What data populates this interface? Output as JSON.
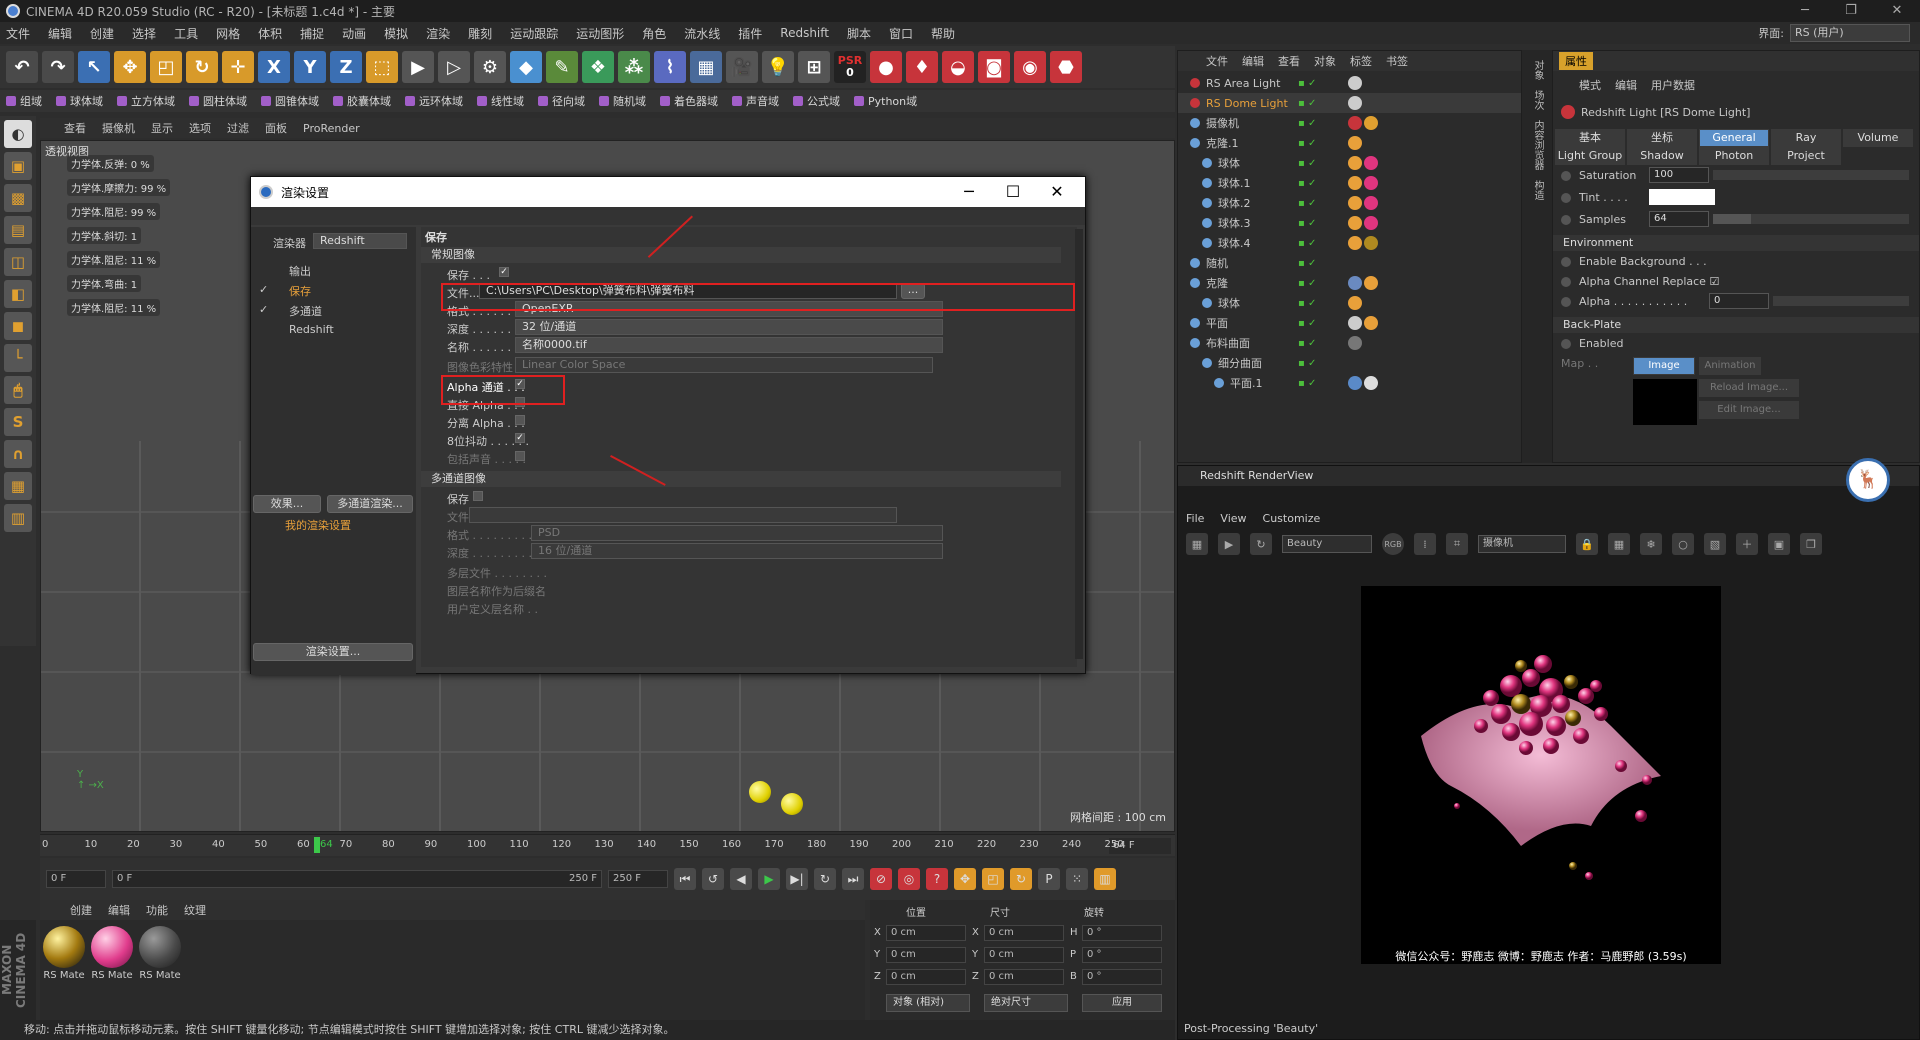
{
  "app": {
    "title": "CINEMA 4D R20.059 Studio (RC - R20) - [未标题 1.c4d *] - 主要",
    "interface_label": "界面:",
    "interface_value": "RS (用户)"
  },
  "menu": [
    "文件",
    "编辑",
    "创建",
    "选择",
    "工具",
    "网格",
    "体积",
    "捕捉",
    "动画",
    "模拟",
    "渲染",
    "雕刻",
    "运动跟踪",
    "运动图形",
    "角色",
    "流水线",
    "插件",
    "Redshift",
    "脚本",
    "窗口",
    "帮助"
  ],
  "toolbar2": [
    "组域",
    "球体域",
    "立方体域",
    "圆柱体域",
    "圆锥体域",
    "胶囊体域",
    "远环体域",
    "线性域",
    "径向域",
    "随机域",
    "着色器域",
    "声音域",
    "公式域",
    "Python域"
  ],
  "psr": "PSR",
  "psr_val": "0",
  "viewport": {
    "menu": [
      "查看",
      "摄像机",
      "显示",
      "选项",
      "过滤",
      "面板",
      "ProRender"
    ],
    "title": "透视视图",
    "grid_spacing": "网格间距 : 100 cm",
    "dynamics": [
      "力学体.反弹:  0 %",
      "力学体.摩擦力:  99 %",
      "力学体.阻尼:  99 %",
      "力学体.斜切:  1",
      "力学体.阻尼:  11 %",
      "力学体.弯曲:  1",
      "力学体.阻尼:  11 %"
    ]
  },
  "timeline": {
    "ticks": [
      "0",
      "10",
      "20",
      "30",
      "40",
      "50",
      "60",
      "70",
      "80",
      "90",
      "100",
      "110",
      "120",
      "130",
      "140",
      "150",
      "160",
      "170",
      "180",
      "190",
      "200",
      "210",
      "220",
      "230",
      "240",
      "250"
    ],
    "current": "64",
    "field": "64 F"
  },
  "transport": {
    "start": "0 F",
    "range_start": "0 F",
    "range_end": "250 F",
    "end": "250 F"
  },
  "materials": {
    "menu": [
      "创建",
      "编辑",
      "功能",
      "纹理"
    ],
    "items": [
      "RS Mate",
      "RS Mate",
      "RS Mate"
    ]
  },
  "coords": {
    "headers": [
      "位置",
      "尺寸",
      "旋转"
    ],
    "pos": [
      "0 cm",
      "0 cm",
      "0 cm"
    ],
    "size": [
      "0 cm",
      "0 cm",
      "0 cm"
    ],
    "rot": [
      "0 °",
      "0 °",
      "0 °"
    ],
    "axes": [
      "X",
      "Y",
      "Z"
    ],
    "size_axes": [
      "X",
      "Y",
      "Z"
    ],
    "rot_axes": [
      "H",
      "P",
      "B"
    ],
    "mode1": "对象 (相对)",
    "mode2": "绝对尺寸",
    "apply": "应用"
  },
  "status": "移动: 点击并拖动鼠标移动元素。按住 SHIFT 键量化移动; 节点编辑模式时按住 SHIFT 键增加选择对象; 按住 CTRL 键减少选择对象。",
  "objmgr": {
    "menu": [
      "文件",
      "编辑",
      "查看",
      "对象",
      "标签",
      "书签"
    ],
    "items": [
      {
        "name": "RS Area Light",
        "indent": 0
      },
      {
        "name": "RS Dome Light",
        "indent": 0,
        "active": true
      },
      {
        "name": "摄像机",
        "indent": 0
      },
      {
        "name": "克隆.1",
        "indent": 0
      },
      {
        "name": "球体",
        "indent": 1
      },
      {
        "name": "球体.1",
        "indent": 1
      },
      {
        "name": "球体.2",
        "indent": 1
      },
      {
        "name": "球体.3",
        "indent": 1
      },
      {
        "name": "球体.4",
        "indent": 1
      },
      {
        "name": "随机",
        "indent": 0
      },
      {
        "name": "克隆",
        "indent": 0
      },
      {
        "name": "球体",
        "indent": 1
      },
      {
        "name": "平面",
        "indent": 0
      },
      {
        "name": "布料曲面",
        "indent": 0
      },
      {
        "name": "细分曲面",
        "indent": 1
      },
      {
        "name": "平面.1",
        "indent": 2
      }
    ]
  },
  "sidetabs": [
    "对象",
    "场次",
    "内容浏览器",
    "构造"
  ],
  "attr": {
    "tab": "属性",
    "menu": [
      "模式",
      "编辑",
      "用户数据"
    ],
    "title": "Redshift Light [RS Dome Light]",
    "tabs1": [
      "基本",
      "坐标",
      "General",
      "Ray",
      "Volume"
    ],
    "tabs2": [
      "Light Group",
      "Shadow",
      "Photon",
      "Project"
    ],
    "saturation_label": "Saturation",
    "saturation": "100",
    "tint_label": "Tint . . . .",
    "samples_label": "Samples",
    "samples": "64",
    "env": "Environment",
    "enable_bg": "Enable Background . . .",
    "alpha_replace": "Alpha Channel Replace",
    "alpha_label": "Alpha . . . . . . . . . . .",
    "alpha": "0",
    "backplate": "Back-Plate",
    "enabled": "Enabled",
    "map": "Map . .",
    "image": "Image",
    "animation": "Animation",
    "reload": "Reload Image...",
    "edit": "Edit Image..."
  },
  "renderview": {
    "title": "Redshift RenderView",
    "menu": [
      "File",
      "View",
      "Customize"
    ],
    "beauty": "Beauty",
    "camera": "摄像机",
    "rgb": "RGB",
    "caption": "微信公众号：野鹿志   微博：野鹿志   作者：马鹿野郎  (3.59s)",
    "post": "Post-Processing 'Beauty'"
  },
  "dialog": {
    "title": "渲染设置",
    "renderer_label": "渲染器",
    "renderer": "Redshift",
    "nav": [
      "输出",
      "保存",
      "多通道",
      "Redshift"
    ],
    "effects": "效果...",
    "multipass_btn": "多通道渲染...",
    "my_settings": "我的渲染设置",
    "render_btn": "渲染设置...",
    "header": "保存",
    "regular": "常规图像",
    "save": "保存 . . .",
    "file": "文件...",
    "path": "C:\\Users\\PC\\Desktop\\弹簧布料\\弹簧布料",
    "format_label": "格式 . . . . . . . . .",
    "format": "OpenEXR",
    "depth_label": "深度 . . . . . . . . .",
    "depth": "32 位/通道",
    "name_label": "名称 . . . . . . . . .",
    "name": "名称0000.tif",
    "colorprofile_label": "图像色彩特性 . . .",
    "colorprofile": "Linear Color Space",
    "alpha": "Alpha 通道 . . .",
    "straight_alpha": "直接 Alpha . . .",
    "separate_alpha": "分离 Alpha . . .",
    "dither": "8位抖动 . . . . . .",
    "sound": "包括声音 . . . . .",
    "mp_section": "多通道图像",
    "mp_save": "保存",
    "mp_file": "文件",
    "mp_format_label": "格式 . . . . . . . . . .",
    "mp_format": "PSD",
    "mp_depth_label": "深度 . . . . . . . . . .",
    "mp_depth": "16 位/通道",
    "mp_layers": "多层文件 . . . . . . . .",
    "mp_layername": "图层名称作为后缀名",
    "mp_userdefined": "用户定义层名称 . ."
  }
}
